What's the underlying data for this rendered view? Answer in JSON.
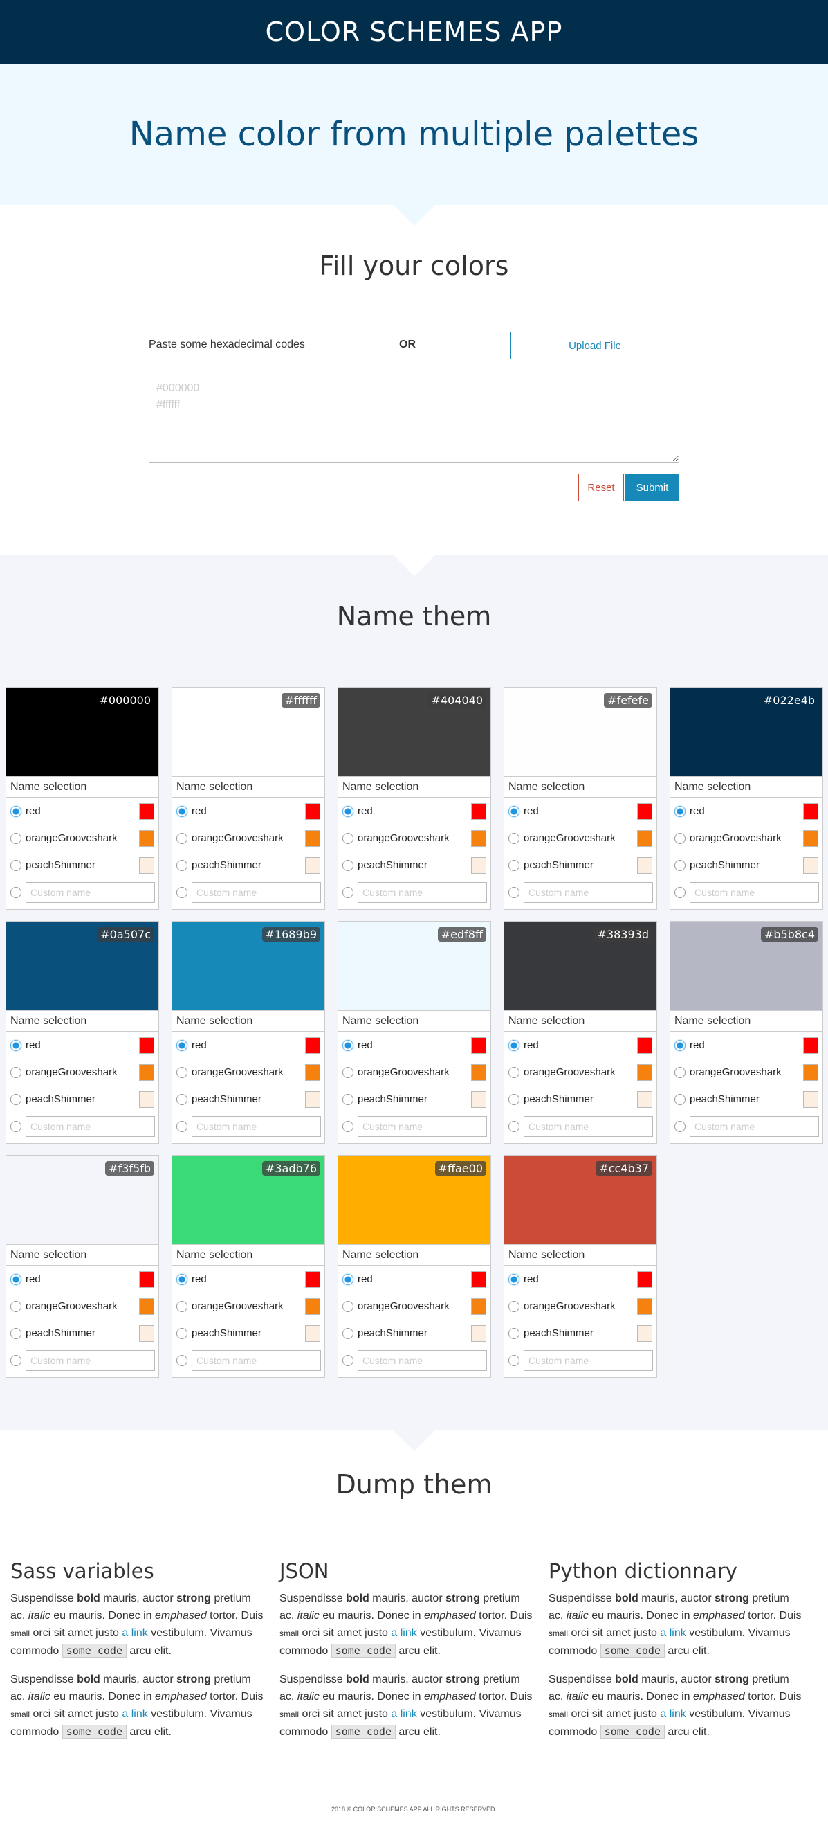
{
  "app": {
    "title": "COLOR SCHEMES APP"
  },
  "hero": {
    "title": "Name color from multiple palettes"
  },
  "fill": {
    "title": "Fill your colors",
    "paste_label": "Paste some hexadecimal codes",
    "or_label": "OR",
    "upload_label": "Upload File",
    "textarea_placeholder": "#000000\n#ffffff",
    "reset_label": "Reset",
    "submit_label": "Submit"
  },
  "name": {
    "title": "Name them",
    "selection_label": "Name selection",
    "custom_placeholder": "Custom name",
    "options": [
      {
        "label": "red",
        "color": "#ff0000"
      },
      {
        "label": "orangeGrooveshark",
        "color": "#f5820f"
      },
      {
        "label": "peachShimmer",
        "color": "#fdeee2"
      }
    ],
    "cards": [
      {
        "hex": "#000000",
        "selected": 0
      },
      {
        "hex": "#ffffff",
        "selected": 0
      },
      {
        "hex": "#404040",
        "selected": 0
      },
      {
        "hex": "#fefefe",
        "selected": 0
      },
      {
        "hex": "#022e4b",
        "selected": 0
      },
      {
        "hex": "#0a507c",
        "selected": 0
      },
      {
        "hex": "#1689b9",
        "selected": 0
      },
      {
        "hex": "#edf8ff",
        "selected": 0
      },
      {
        "hex": "#38393d",
        "selected": 0
      },
      {
        "hex": "#b5b8c4",
        "selected": 0
      },
      {
        "hex": "#f3f5fb",
        "selected": 0
      },
      {
        "hex": "#3adb76",
        "selected": 0
      },
      {
        "hex": "#ffae00",
        "selected": 0
      },
      {
        "hex": "#cc4b37",
        "selected": 0
      }
    ]
  },
  "dump": {
    "title": "Dump them",
    "columns": [
      {
        "title": "Sass variables"
      },
      {
        "title": "JSON"
      },
      {
        "title": "Python dictionnary"
      }
    ],
    "para": {
      "t1": "Suspendisse ",
      "b1": "bold",
      "t2": " mauris, auctor ",
      "b2": "strong",
      "t3": " pretium ac, ",
      "i1": "italic",
      "t4": " eu mauris. Donec in ",
      "i2": "emphased",
      "t5": " tortor. Duis ",
      "s1": "small",
      "t6": " orci sit amet justo ",
      "a1": "a link",
      "t7": " vestibulum. Vivamus commodo ",
      "c1": "some code",
      "t8": " arcu elit."
    }
  },
  "footer": {
    "text": "2018 © COLOR SCHEMES APP ALL RIGHTS RESERVED."
  }
}
